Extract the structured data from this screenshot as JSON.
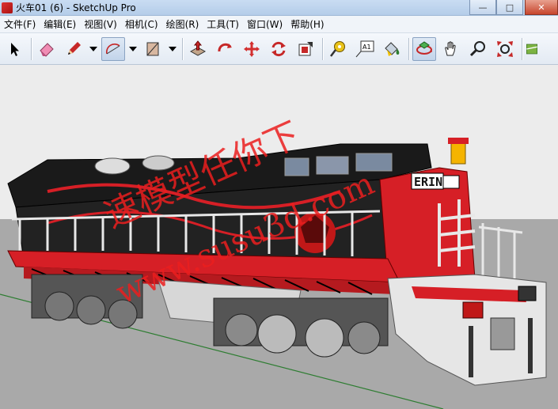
{
  "window": {
    "title": "火车01 (6) - SketchUp Pro",
    "minimize_glyph": "—",
    "maximize_glyph": "□",
    "close_glyph": "✕"
  },
  "menu": [
    {
      "label": "文件(F)"
    },
    {
      "label": "编辑(E)"
    },
    {
      "label": "视图(V)"
    },
    {
      "label": "相机(C)"
    },
    {
      "label": "绘图(R)"
    },
    {
      "label": "工具(T)"
    },
    {
      "label": "窗口(W)"
    },
    {
      "label": "帮助(H)"
    }
  ],
  "toolbar": {
    "text_tool_glyph": "A1",
    "tools": [
      "select-tool-icon",
      "eraser-icon",
      "pencil-icon",
      "arc-icon",
      "rectangle-icon",
      "push-pull-icon",
      "follow-me-icon",
      "move-icon",
      "rotate-icon",
      "offset-icon",
      "tape-measure-icon",
      "text-tool-icon",
      "paint-bucket-icon",
      "orbit-icon",
      "pan-icon",
      "zoom-icon",
      "zoom-extents-icon",
      "map-icon"
    ]
  },
  "viewport": {
    "locomotive_sign": "ERIN",
    "watermark_line1": "速模型任你下",
    "watermark_line2": "www.susu3d.com",
    "colors": {
      "sky": "#ececec",
      "ground": "#a8a8a8",
      "body_black": "#1a1a1a",
      "body_red": "#d61f26",
      "rail_white": "#e8e8e8"
    }
  }
}
